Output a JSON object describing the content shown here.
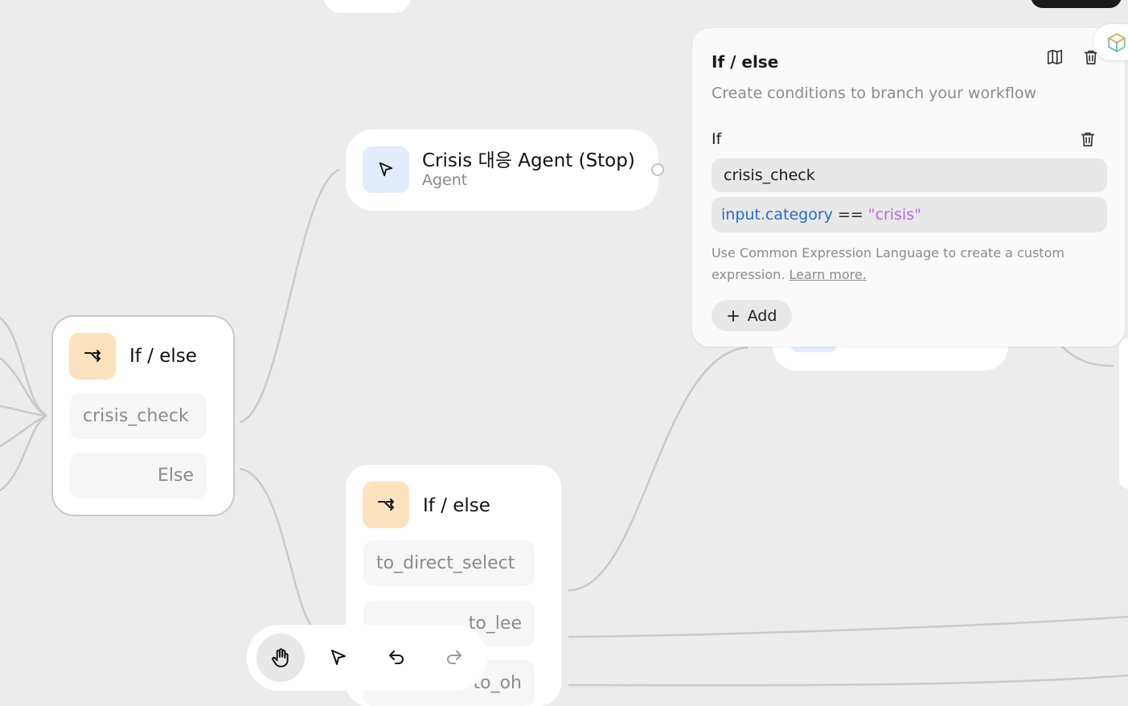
{
  "canvas": {
    "agent_node": {
      "title": "Crisis 대응 Agent (Stop)",
      "subtitle": "Agent",
      "icon": "cursor-icon"
    },
    "ifelse_left": {
      "title": "If / else",
      "icon": "branch-icon",
      "conditions": [
        "crisis_check"
      ],
      "else_label": "Else"
    },
    "ifelse_bottom": {
      "title": "If / else",
      "icon": "branch-icon",
      "conditions": [
        "to_direct_select",
        "to_lee",
        "to_oh"
      ]
    }
  },
  "panel": {
    "title": "If / else",
    "description": "Create conditions to branch your workflow",
    "if_label": "If",
    "condition_name": "crisis_check",
    "expression": {
      "field": "input.category",
      "operator": "==",
      "value": "\"crisis\""
    },
    "hint": "Use Common Expression Language to create a custom expression.",
    "learn_more": "Learn more.",
    "add_label": "Add",
    "icons": [
      "book-icon",
      "trash-icon"
    ]
  },
  "toolbar": {
    "tools": [
      "hand-icon",
      "pointer-icon",
      "undo-icon",
      "redo-icon"
    ],
    "active": "hand-icon"
  },
  "colors": {
    "expression_field": "#1f6fd1",
    "expression_value": "#b36ae2",
    "orange_icon_bg": "#fde2c0",
    "blue_icon_bg": "#e3ecfd"
  }
}
